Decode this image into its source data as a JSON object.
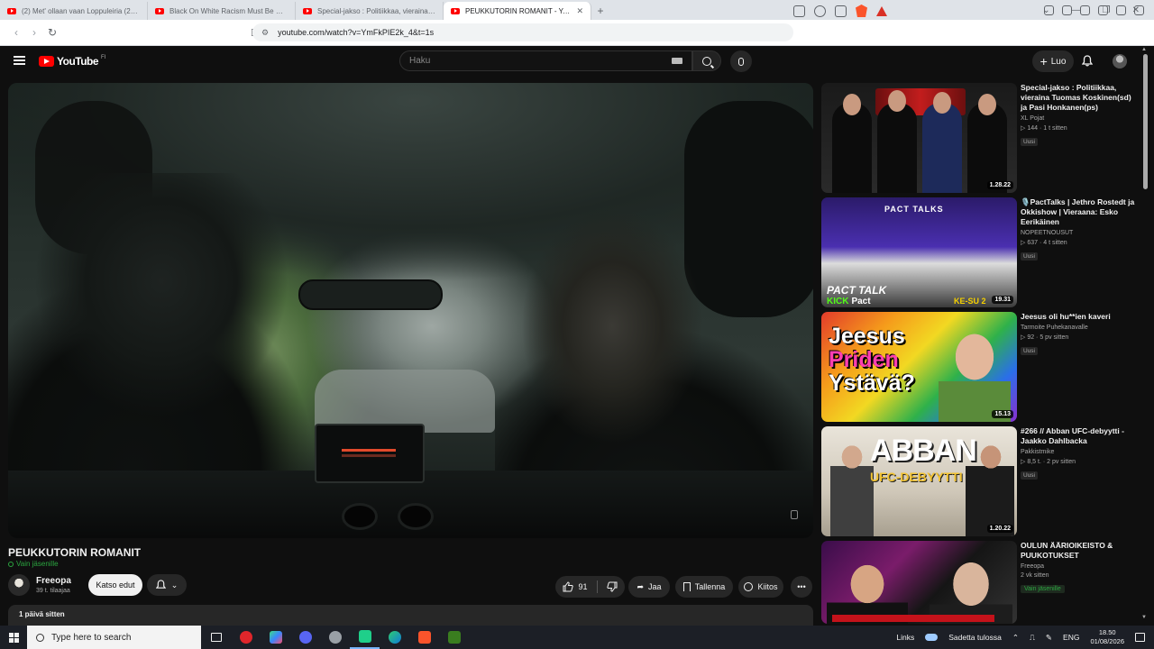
{
  "browser": {
    "tabs": [
      {
        "title": "(2) Met' ollaan vaan Loppuleiria (200...",
        "active": false
      },
      {
        "title": "Black On White Racism Must Be STO...",
        "active": false
      },
      {
        "title": "Special-jakso : Politiikkaa, vieraina To...",
        "active": false
      },
      {
        "title": "PEUKKUTORIN ROMANIT - Yo...",
        "active": true
      }
    ],
    "new_tab": "+",
    "url": "youtube.com/watch?v=YmFkPIE2k_4&t=1s"
  },
  "header": {
    "logo_text": "YouTube",
    "logo_country": "FI",
    "search_placeholder": "Haku",
    "create_label": "Luo"
  },
  "video": {
    "title": "PEUKKUTORIN ROMANIT",
    "members_only": "Vain jäsenille",
    "channel_name": "Freeopa",
    "subscribers": "39 t. tilaajaa",
    "join_label": "Katso edut",
    "likes": "91",
    "share_label": "Jaa",
    "save_label": "Tallenna",
    "thanks_label": "Kiitos",
    "description_date": "1 päivä sitten"
  },
  "sidebar": {
    "items": [
      {
        "title": "Special-jakso : Politiikkaa, vieraina Tuomas Koskinen(sd) ja Pasi Honkanen(ps)",
        "channel": "XL Pojat",
        "views": "▷ 144 · 1 t sitten",
        "badge": "Uusi",
        "duration": "1.28.22"
      },
      {
        "title": "🎙️PactTalks | Jethro Rostedt ja Okkishow | Vieraana: Esko Eerikäinen",
        "channel": "NOPEETNOUSUT",
        "views": "▷ 637 · 4 t sitten",
        "badge": "Uusi",
        "duration": "19.31"
      },
      {
        "title": "Jeesus oli hu**ien kaveri",
        "channel": "Tarmoite Puhekanavalle",
        "views": "▷ 92 · 5 pv sitten",
        "badge": "Uusi",
        "duration": "15.13"
      },
      {
        "title": "#266 // Abban UFC-debyytti - Jaakko Dahlbacka",
        "channel": "Pakkistmike",
        "views": "▷ 8,5 t. · 2 pv sitten",
        "badge": "Uusi",
        "duration": "1.20.22"
      },
      {
        "title": "OULUN ÄÄRIOIKEISTO & PUUKOTUKSET",
        "channel": "Freeopa",
        "views": "2 vk sitten",
        "badge": "Vain jäsenille",
        "duration": ""
      }
    ],
    "thumb_text": {
      "pact_logo": "PACT TALKS",
      "pact_caption": "PACT TALK",
      "pact_kick": "KICK",
      "pact_name": "Pact",
      "pact_days": "KE-SU 2",
      "jeesus_1": "Jeesus",
      "jeesus_2": "Priden",
      "jeesus_3": "Ystävä?",
      "abban_1": "ABBAN",
      "abban_2": "UFC-DEBYYTTI"
    }
  },
  "taskbar": {
    "search_placeholder": "Type here to search",
    "links_label": "Links",
    "weather": "Sadetta tulossa",
    "language": "ENG",
    "time": "18.50",
    "date": "01/08/2026"
  },
  "colors": {
    "accent_red": "#ff0000",
    "members_green": "#2ba640",
    "background": "#0f0f0f"
  }
}
